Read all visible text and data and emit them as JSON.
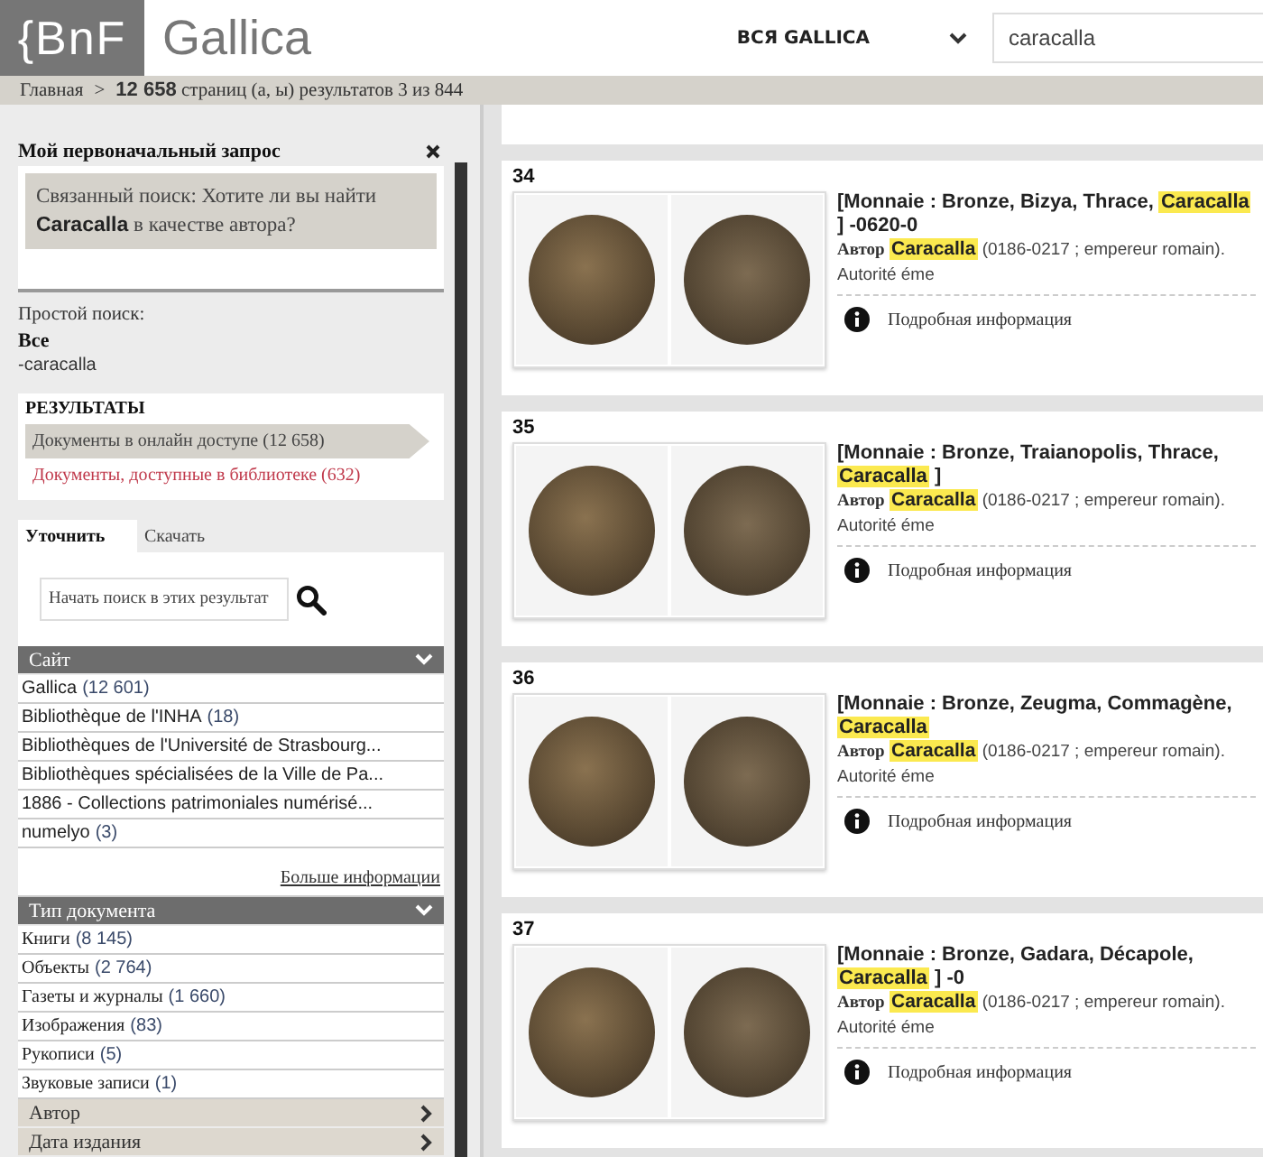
{
  "header": {
    "logo": "{BnF",
    "brand": "Gallica",
    "scope": "ВСЯ GALLICA",
    "search_value": "caracalla"
  },
  "breadcrumb": {
    "home": "Главная",
    "separator": ">",
    "summary": "**12 658** страниц (а, ы) результатов 3 из 844"
  },
  "sidebar": {
    "initial_query": {
      "title": "Мой первоначальный запрос",
      "related": "Связанный поиск: Хотите ли вы найти **Caracalla** в качестве автора?"
    },
    "simple_search": {
      "label": "Простой поиск:",
      "scope": "Все",
      "term": "-caracalla"
    },
    "results": {
      "title": "РЕЗУЛЬТАТЫ",
      "items": [
        {
          "label": "Документы в онлайн доступе (12 658)",
          "selected": true
        },
        {
          "label": "Документы, доступные в библиотеке (632)",
          "selected": false
        }
      ]
    },
    "tabs": [
      {
        "label": "Уточнить",
        "selected": true
      },
      {
        "label": "Скачать",
        "selected": false
      }
    ],
    "refine": {
      "placeholder": "Начать поиск в этих результат"
    },
    "facets": [
      {
        "title": "Сайт",
        "expanded": true,
        "kind": "sans",
        "items": [
          {
            "label": "Gallica",
            "count": "(12 601)"
          },
          {
            "label": "Bibliothèque de l'INHA",
            "count": "(18)"
          },
          {
            "label": "Bibliothèques de l'Université de Strasbourg..."
          },
          {
            "label": "Bibliothèques spécialisées de la Ville de Pa..."
          },
          {
            "label": "1886 - Collections patrimoniales numérisé..."
          },
          {
            "label": "numelyo",
            "count": "(3)"
          }
        ],
        "more": "Больше информации"
      },
      {
        "title": "Тип документа",
        "expanded": true,
        "kind": "serif",
        "items": [
          {
            "label": "Книги",
            "count": "(8 145)"
          },
          {
            "label": "Объекты",
            "count": "(2 764)"
          },
          {
            "label": "Газеты и журналы",
            "count": "(1 660)"
          },
          {
            "label": "Изображения",
            "count": "(83)"
          },
          {
            "label": "Рукописи",
            "count": "(5)"
          },
          {
            "label": "Звуковые записи",
            "count": "(1)"
          }
        ]
      },
      {
        "title": "Автор",
        "expanded": false
      },
      {
        "title": "Дата издания",
        "expanded": false
      }
    ]
  },
  "results": [
    {
      "number": "34",
      "title_prefix": "[Monnaie : Bronze, Bizya, Thrace, ",
      "title_highlight": "Caracalla",
      "title_suffix": " ] -0620-0",
      "author_label": "Автор",
      "author_highlight": "Caracalla",
      "author_rest": "(0186-0217 ; empereur romain). Autorité éme",
      "info": "Подробная информация"
    },
    {
      "number": "35",
      "title_prefix": "[Monnaie : Bronze, Traianopolis, Thrace, ",
      "title_highlight": "Caracalla",
      "title_suffix": " ]",
      "author_label": "Автор",
      "author_highlight": "Caracalla",
      "author_rest": "(0186-0217 ; empereur romain). Autorité éme",
      "info": "Подробная информация"
    },
    {
      "number": "36",
      "title_prefix": "[Monnaie : Bronze, Zeugma, Commagène, ",
      "title_highlight": "Caracalla",
      "author_label": "Автор",
      "author_highlight": "Caracalla",
      "author_rest": "(0186-0217 ; empereur romain). Autorité éme",
      "info": "Подробная информация"
    },
    {
      "number": "37",
      "title_prefix": "[Monnaie : Bronze, Gadara, Décapole, ",
      "title_highlight": "Caracalla",
      "title_suffix": " ] -0",
      "author_label": "Автор",
      "author_highlight": "Caracalla",
      "author_rest": "(0186-0217 ; empereur romain). Autorité éme",
      "info": "Подробная информация"
    }
  ]
}
